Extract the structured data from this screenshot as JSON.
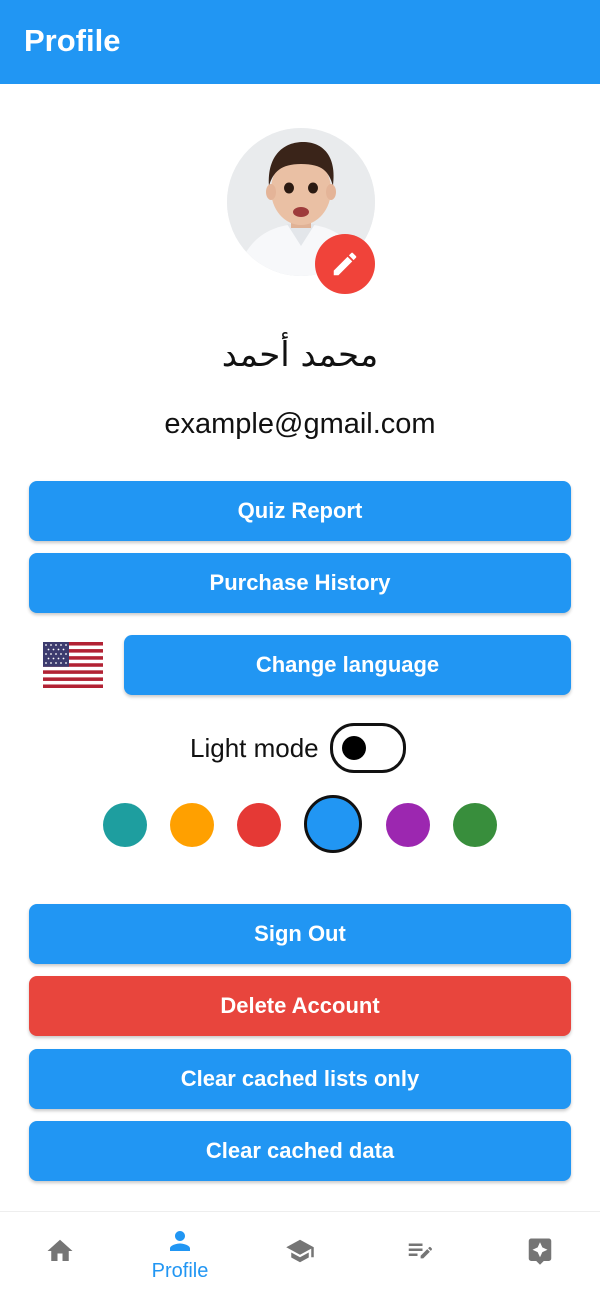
{
  "appbar": {
    "title": "Profile"
  },
  "profile": {
    "name": "محمد أحمد",
    "email": "example@gmail.com"
  },
  "buttons": {
    "quiz_report": "Quiz Report",
    "purchase_history": "Purchase History",
    "change_language": "Change language",
    "sign_out": "Sign Out",
    "delete_account": "Delete Account",
    "clear_cached_lists": "Clear cached lists only",
    "clear_cached_data": "Clear cached data"
  },
  "theme": {
    "mode_label": "Light mode",
    "dark_mode_on": false,
    "colors": [
      "#1E9E9F",
      "#FFA000",
      "#E53935",
      "#2196F3",
      "#9C27B0",
      "#388E3C"
    ],
    "selected_color": "#2196F3"
  },
  "language": {
    "flag_icon": "us-flag-icon"
  },
  "bottom_nav": {
    "items": [
      {
        "icon": "home-icon",
        "label": ""
      },
      {
        "icon": "person-icon",
        "label": "Profile"
      },
      {
        "icon": "school-icon",
        "label": ""
      },
      {
        "icon": "edit-note-icon",
        "label": ""
      },
      {
        "icon": "badge-star-icon",
        "label": ""
      }
    ],
    "active_index": 1
  },
  "accent_color": "#2196F3",
  "danger_color": "#E8453D"
}
